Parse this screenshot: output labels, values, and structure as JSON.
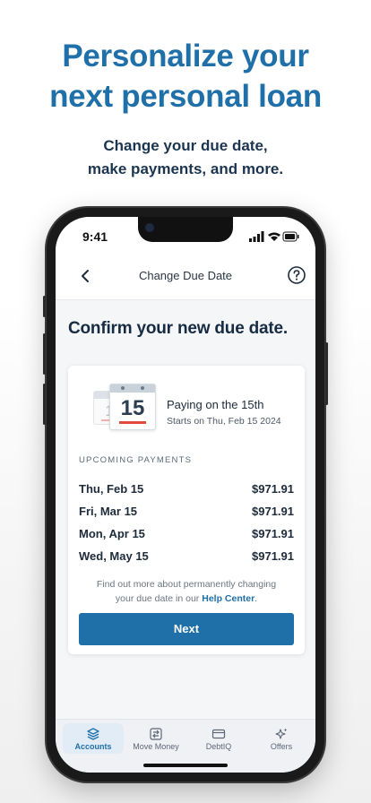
{
  "marketing": {
    "headline_line1": "Personalize your",
    "headline_line2": "next personal loan",
    "subhead_line1": "Change your due date,",
    "subhead_line2": "make payments, and more."
  },
  "status_bar": {
    "time": "9:41"
  },
  "nav": {
    "title": "Change Due Date",
    "back_icon": "chevron-left-icon",
    "help_icon": "question-circle-icon"
  },
  "page": {
    "heading": "Confirm your new due date."
  },
  "calendar_graphic": {
    "back_day": "1",
    "front_day": "15"
  },
  "summary": {
    "title": "Paying on the 15th",
    "subtitle": "Starts on Thu, Feb 15 2024"
  },
  "upcoming": {
    "label": "UPCOMING PAYMENTS",
    "rows": [
      {
        "date": "Thu, Feb 15",
        "amount": "$971.91"
      },
      {
        "date": "Fri, Mar 15",
        "amount": "$971.91"
      },
      {
        "date": "Mon, Apr 15",
        "amount": "$971.91"
      },
      {
        "date": "Wed, May 15",
        "amount": "$971.91"
      }
    ]
  },
  "note": {
    "line1": "Find out more about permanently changing",
    "line2_prefix": "your due date in our ",
    "link": "Help Center",
    "line2_suffix": "."
  },
  "next_button": {
    "label": "Next"
  },
  "tabs": [
    {
      "label": "Accounts",
      "icon": "layers-icon",
      "active": true
    },
    {
      "label": "Move Money",
      "icon": "transfer-icon",
      "active": false
    },
    {
      "label": "DebtIQ",
      "icon": "card-icon",
      "active": false
    },
    {
      "label": "Offers",
      "icon": "sparkle-icon",
      "active": false
    }
  ],
  "colors": {
    "brand_blue": "#1f6fa8",
    "navy": "#172b43",
    "accent_red": "#e04b3c"
  }
}
